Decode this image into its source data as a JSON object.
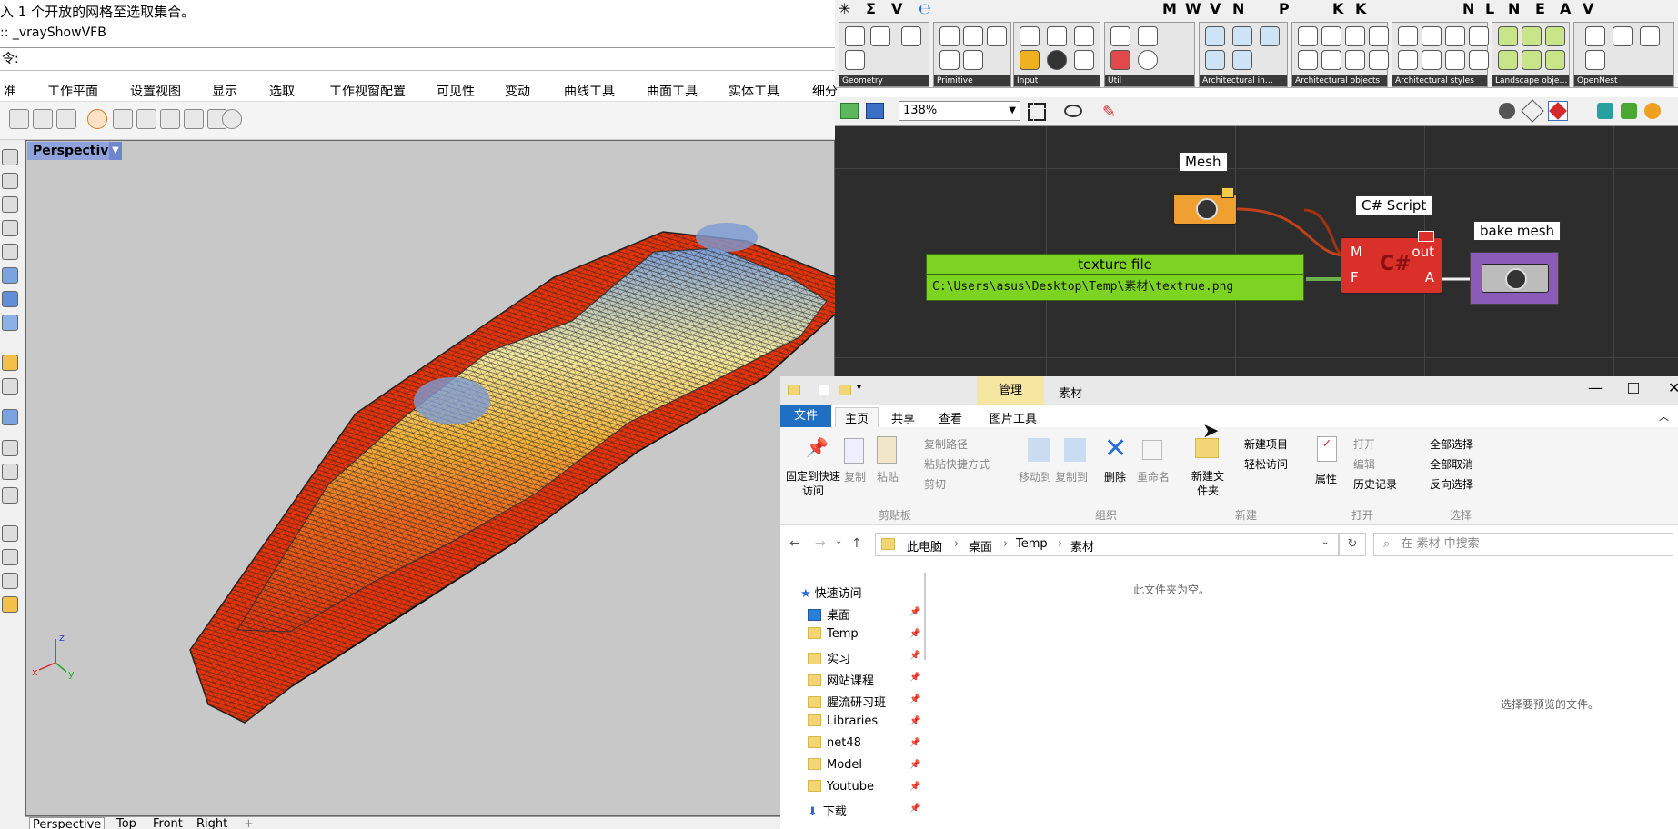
{
  "rhino": {
    "command_history": [
      "入 1 个开放的网格至选取集合。",
      ":: _vrayShowVFB"
    ],
    "prompt": "令:",
    "menu": [
      "准",
      "工作平面",
      "设置视图",
      "显示",
      "选取",
      "工作视窗配置",
      "可见性",
      "变动",
      "曲线工具",
      "曲面工具",
      "实体工具",
      "细分"
    ],
    "viewport_label": "Perspective",
    "viewport_tabs": [
      "Perspective",
      "Top",
      "Front",
      "Right",
      "+"
    ],
    "axes": {
      "x": "x",
      "y": "y",
      "z": "z"
    }
  },
  "grasshopper": {
    "top_icons": [
      "✳",
      "Σ",
      "V",
      "℮",
      "M",
      "W",
      "V",
      "N",
      "P",
      "K",
      "K",
      "N",
      "L",
      "N",
      "E",
      "A",
      "V"
    ],
    "ribbon_groups": [
      "Geometry",
      "Primitive",
      "Input",
      "Util",
      "Architectural in…",
      "Architectural objects",
      "Architectural styles",
      "Landscape obje…",
      "OpenNest"
    ],
    "zoom": "138%",
    "nodes": {
      "mesh_label": "Mesh",
      "csharp_label": "C# Script",
      "csharp_inputs": [
        "M",
        "F"
      ],
      "csharp_outputs": [
        "out",
        "A"
      ],
      "bake_label": "bake mesh",
      "texture_title": "texture file",
      "texture_value": "C:\\Users\\asus\\Desktop\\Temp\\素材\\textrue.png"
    }
  },
  "explorer": {
    "title": "素材",
    "manage_tab": "管理",
    "tabs": [
      "文件",
      "主页",
      "共享",
      "查看",
      "图片工具"
    ],
    "ribbon": {
      "pin": "固定到快速访问",
      "copy": "复制",
      "paste": "粘贴",
      "copy_path": "复制路径",
      "paste_shortcut": "粘贴快捷方式",
      "cut": "剪切",
      "move_to": "移动到",
      "copy_to": "复制到",
      "delete": "删除",
      "rename": "重命名",
      "new_folder": "新建文件夹",
      "new_item": "新建项目",
      "easy_access": "轻松访问",
      "properties": "属性",
      "open": "打开",
      "edit": "编辑",
      "history": "历史记录",
      "select_all": "全部选择",
      "select_none": "全部取消",
      "invert": "反向选择",
      "groups": [
        "剪贴板",
        "组织",
        "新建",
        "打开",
        "选择"
      ]
    },
    "breadcrumb": [
      "此电脑",
      "桌面",
      "Temp",
      "素材"
    ],
    "search_placeholder": "在 素材 中搜索",
    "nav_items": [
      "快速访问",
      "桌面",
      "Temp",
      "实习",
      "网站课程",
      "腥流研习班",
      "Libraries",
      "net48",
      "Model",
      "Youtube",
      "下载"
    ],
    "empty_text": "此文件夹为空。",
    "preview_text": "选择要预览的文件。"
  }
}
